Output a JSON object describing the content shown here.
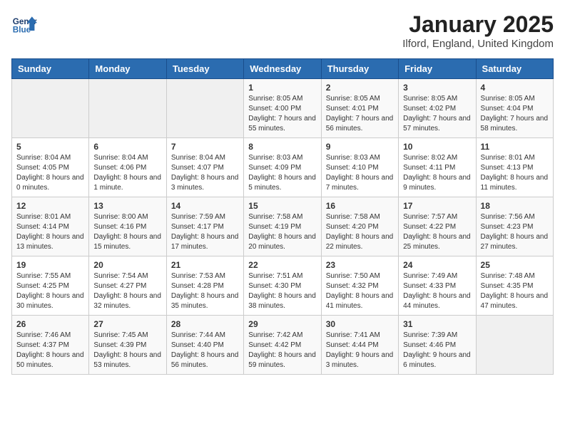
{
  "header": {
    "logo_line1": "General",
    "logo_line2": "Blue",
    "month": "January 2025",
    "location": "Ilford, England, United Kingdom"
  },
  "weekdays": [
    "Sunday",
    "Monday",
    "Tuesday",
    "Wednesday",
    "Thursday",
    "Friday",
    "Saturday"
  ],
  "weeks": [
    [
      {
        "day": "",
        "sunrise": "",
        "sunset": "",
        "daylight": ""
      },
      {
        "day": "",
        "sunrise": "",
        "sunset": "",
        "daylight": ""
      },
      {
        "day": "",
        "sunrise": "",
        "sunset": "",
        "daylight": ""
      },
      {
        "day": "1",
        "sunrise": "Sunrise: 8:05 AM",
        "sunset": "Sunset: 4:00 PM",
        "daylight": "Daylight: 7 hours and 55 minutes."
      },
      {
        "day": "2",
        "sunrise": "Sunrise: 8:05 AM",
        "sunset": "Sunset: 4:01 PM",
        "daylight": "Daylight: 7 hours and 56 minutes."
      },
      {
        "day": "3",
        "sunrise": "Sunrise: 8:05 AM",
        "sunset": "Sunset: 4:02 PM",
        "daylight": "Daylight: 7 hours and 57 minutes."
      },
      {
        "day": "4",
        "sunrise": "Sunrise: 8:05 AM",
        "sunset": "Sunset: 4:04 PM",
        "daylight": "Daylight: 7 hours and 58 minutes."
      }
    ],
    [
      {
        "day": "5",
        "sunrise": "Sunrise: 8:04 AM",
        "sunset": "Sunset: 4:05 PM",
        "daylight": "Daylight: 8 hours and 0 minutes."
      },
      {
        "day": "6",
        "sunrise": "Sunrise: 8:04 AM",
        "sunset": "Sunset: 4:06 PM",
        "daylight": "Daylight: 8 hours and 1 minute."
      },
      {
        "day": "7",
        "sunrise": "Sunrise: 8:04 AM",
        "sunset": "Sunset: 4:07 PM",
        "daylight": "Daylight: 8 hours and 3 minutes."
      },
      {
        "day": "8",
        "sunrise": "Sunrise: 8:03 AM",
        "sunset": "Sunset: 4:09 PM",
        "daylight": "Daylight: 8 hours and 5 minutes."
      },
      {
        "day": "9",
        "sunrise": "Sunrise: 8:03 AM",
        "sunset": "Sunset: 4:10 PM",
        "daylight": "Daylight: 8 hours and 7 minutes."
      },
      {
        "day": "10",
        "sunrise": "Sunrise: 8:02 AM",
        "sunset": "Sunset: 4:11 PM",
        "daylight": "Daylight: 8 hours and 9 minutes."
      },
      {
        "day": "11",
        "sunrise": "Sunrise: 8:01 AM",
        "sunset": "Sunset: 4:13 PM",
        "daylight": "Daylight: 8 hours and 11 minutes."
      }
    ],
    [
      {
        "day": "12",
        "sunrise": "Sunrise: 8:01 AM",
        "sunset": "Sunset: 4:14 PM",
        "daylight": "Daylight: 8 hours and 13 minutes."
      },
      {
        "day": "13",
        "sunrise": "Sunrise: 8:00 AM",
        "sunset": "Sunset: 4:16 PM",
        "daylight": "Daylight: 8 hours and 15 minutes."
      },
      {
        "day": "14",
        "sunrise": "Sunrise: 7:59 AM",
        "sunset": "Sunset: 4:17 PM",
        "daylight": "Daylight: 8 hours and 17 minutes."
      },
      {
        "day": "15",
        "sunrise": "Sunrise: 7:58 AM",
        "sunset": "Sunset: 4:19 PM",
        "daylight": "Daylight: 8 hours and 20 minutes."
      },
      {
        "day": "16",
        "sunrise": "Sunrise: 7:58 AM",
        "sunset": "Sunset: 4:20 PM",
        "daylight": "Daylight: 8 hours and 22 minutes."
      },
      {
        "day": "17",
        "sunrise": "Sunrise: 7:57 AM",
        "sunset": "Sunset: 4:22 PM",
        "daylight": "Daylight: 8 hours and 25 minutes."
      },
      {
        "day": "18",
        "sunrise": "Sunrise: 7:56 AM",
        "sunset": "Sunset: 4:23 PM",
        "daylight": "Daylight: 8 hours and 27 minutes."
      }
    ],
    [
      {
        "day": "19",
        "sunrise": "Sunrise: 7:55 AM",
        "sunset": "Sunset: 4:25 PM",
        "daylight": "Daylight: 8 hours and 30 minutes."
      },
      {
        "day": "20",
        "sunrise": "Sunrise: 7:54 AM",
        "sunset": "Sunset: 4:27 PM",
        "daylight": "Daylight: 8 hours and 32 minutes."
      },
      {
        "day": "21",
        "sunrise": "Sunrise: 7:53 AM",
        "sunset": "Sunset: 4:28 PM",
        "daylight": "Daylight: 8 hours and 35 minutes."
      },
      {
        "day": "22",
        "sunrise": "Sunrise: 7:51 AM",
        "sunset": "Sunset: 4:30 PM",
        "daylight": "Daylight: 8 hours and 38 minutes."
      },
      {
        "day": "23",
        "sunrise": "Sunrise: 7:50 AM",
        "sunset": "Sunset: 4:32 PM",
        "daylight": "Daylight: 8 hours and 41 minutes."
      },
      {
        "day": "24",
        "sunrise": "Sunrise: 7:49 AM",
        "sunset": "Sunset: 4:33 PM",
        "daylight": "Daylight: 8 hours and 44 minutes."
      },
      {
        "day": "25",
        "sunrise": "Sunrise: 7:48 AM",
        "sunset": "Sunset: 4:35 PM",
        "daylight": "Daylight: 8 hours and 47 minutes."
      }
    ],
    [
      {
        "day": "26",
        "sunrise": "Sunrise: 7:46 AM",
        "sunset": "Sunset: 4:37 PM",
        "daylight": "Daylight: 8 hours and 50 minutes."
      },
      {
        "day": "27",
        "sunrise": "Sunrise: 7:45 AM",
        "sunset": "Sunset: 4:39 PM",
        "daylight": "Daylight: 8 hours and 53 minutes."
      },
      {
        "day": "28",
        "sunrise": "Sunrise: 7:44 AM",
        "sunset": "Sunset: 4:40 PM",
        "daylight": "Daylight: 8 hours and 56 minutes."
      },
      {
        "day": "29",
        "sunrise": "Sunrise: 7:42 AM",
        "sunset": "Sunset: 4:42 PM",
        "daylight": "Daylight: 8 hours and 59 minutes."
      },
      {
        "day": "30",
        "sunrise": "Sunrise: 7:41 AM",
        "sunset": "Sunset: 4:44 PM",
        "daylight": "Daylight: 9 hours and 3 minutes."
      },
      {
        "day": "31",
        "sunrise": "Sunrise: 7:39 AM",
        "sunset": "Sunset: 4:46 PM",
        "daylight": "Daylight: 9 hours and 6 minutes."
      },
      {
        "day": "",
        "sunrise": "",
        "sunset": "",
        "daylight": ""
      }
    ]
  ]
}
